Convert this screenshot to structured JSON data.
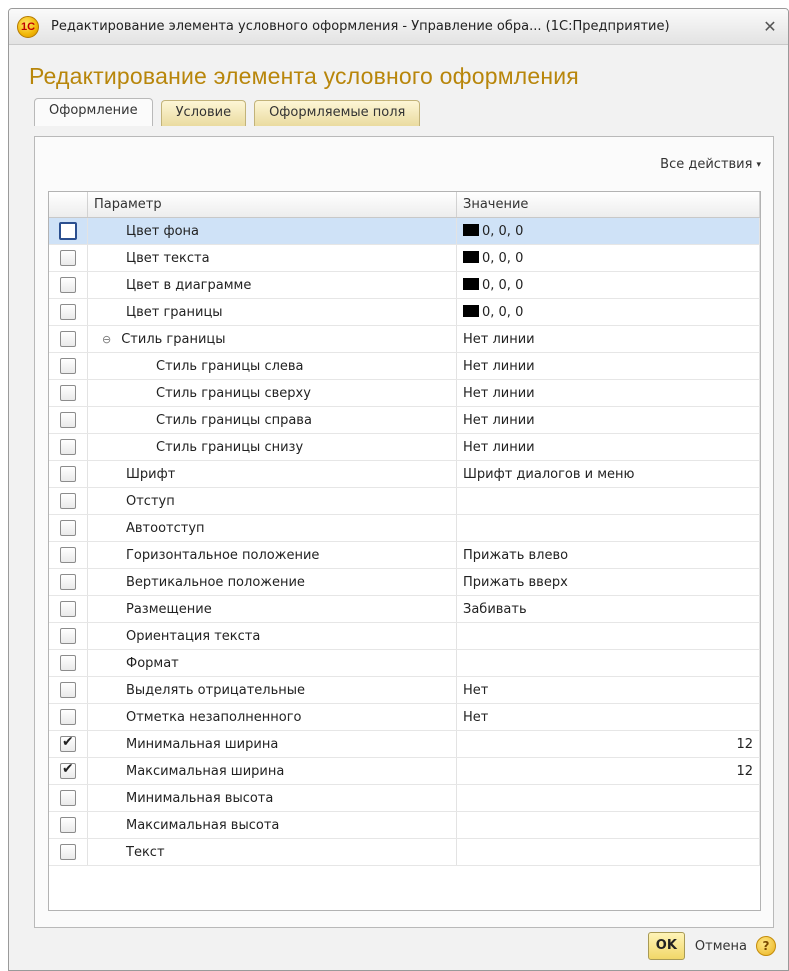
{
  "window": {
    "title": "Редактирование элемента условного оформления - Управление обра... (1С:Предприятие)",
    "logo_text": "1С",
    "close_glyph": "✕"
  },
  "page": {
    "title": "Редактирование элемента условного оформления"
  },
  "tabs": [
    {
      "label": "Оформление",
      "active": true
    },
    {
      "label": "Условие",
      "active": false
    },
    {
      "label": "Оформляемые поля",
      "active": false
    }
  ],
  "toolbar": {
    "all_actions": "Все действия",
    "caret": "▾"
  },
  "grid": {
    "headers": {
      "use": "",
      "param": "Параметр",
      "value": "Значение"
    },
    "rows": [
      {
        "checked": false,
        "selected": true,
        "level": 0,
        "param": "Цвет фона",
        "value": "0, 0, 0",
        "swatch": "#000000"
      },
      {
        "checked": false,
        "level": 0,
        "param": "Цвет текста",
        "value": "0, 0, 0",
        "swatch": "#000000"
      },
      {
        "checked": false,
        "level": 0,
        "param": "Цвет в диаграмме",
        "value": "0, 0, 0",
        "swatch": "#000000"
      },
      {
        "checked": false,
        "level": 0,
        "param": "Цвет границы",
        "value": "0, 0, 0",
        "swatch": "#000000"
      },
      {
        "checked": false,
        "level": 0,
        "group": true,
        "param": "Стиль границы",
        "value": "Нет линии"
      },
      {
        "checked": false,
        "level": 1,
        "param": "Стиль границы слева",
        "value": "Нет линии"
      },
      {
        "checked": false,
        "level": 1,
        "param": "Стиль границы сверху",
        "value": "Нет линии"
      },
      {
        "checked": false,
        "level": 1,
        "param": "Стиль границы справа",
        "value": "Нет линии"
      },
      {
        "checked": false,
        "level": 1,
        "param": "Стиль границы снизу",
        "value": "Нет линии"
      },
      {
        "checked": false,
        "level": 0,
        "param": "Шрифт",
        "value": "Шрифт диалогов и меню"
      },
      {
        "checked": false,
        "level": 0,
        "param": "Отступ",
        "value": ""
      },
      {
        "checked": false,
        "level": 0,
        "param": "Автоотступ",
        "value": ""
      },
      {
        "checked": false,
        "level": 0,
        "param": "Горизонтальное положение",
        "value": "Прижать влево"
      },
      {
        "checked": false,
        "level": 0,
        "param": "Вертикальное положение",
        "value": "Прижать вверх"
      },
      {
        "checked": false,
        "level": 0,
        "param": "Размещение",
        "value": "Забивать"
      },
      {
        "checked": false,
        "level": 0,
        "param": "Ориентация текста",
        "value": ""
      },
      {
        "checked": false,
        "level": 0,
        "param": "Формат",
        "value": ""
      },
      {
        "checked": false,
        "level": 0,
        "param": "Выделять отрицательные",
        "value": "Нет"
      },
      {
        "checked": false,
        "level": 0,
        "param": "Отметка незаполненного",
        "value": "Нет"
      },
      {
        "checked": true,
        "level": 0,
        "param": "Минимальная ширина",
        "value": "12",
        "numeric": true
      },
      {
        "checked": true,
        "level": 0,
        "param": "Максимальная ширина",
        "value": "12",
        "numeric": true
      },
      {
        "checked": false,
        "level": 0,
        "param": "Минимальная высота",
        "value": ""
      },
      {
        "checked": false,
        "level": 0,
        "param": "Максимальная высота",
        "value": ""
      },
      {
        "checked": false,
        "level": 0,
        "param": "Текст",
        "value": ""
      }
    ]
  },
  "footer": {
    "ok_label": "OK",
    "cancel_label": "Отмена",
    "help_glyph": "?"
  },
  "icons": {
    "expander": "⊖",
    "check": "✔"
  },
  "colors": {
    "accent_title": "#b8860b",
    "selection": "#cfe2f7"
  }
}
